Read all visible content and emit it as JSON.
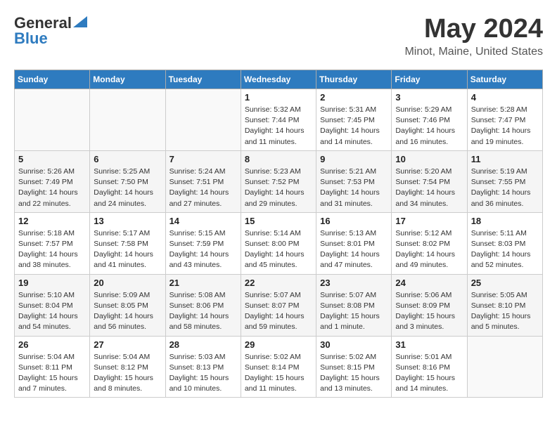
{
  "header": {
    "logo_line1": "General",
    "logo_line2": "Blue",
    "main_title": "May 2024",
    "subtitle": "Minot, Maine, United States"
  },
  "weekdays": [
    "Sunday",
    "Monday",
    "Tuesday",
    "Wednesday",
    "Thursday",
    "Friday",
    "Saturday"
  ],
  "weeks": [
    [
      {
        "day": "",
        "info": ""
      },
      {
        "day": "",
        "info": ""
      },
      {
        "day": "",
        "info": ""
      },
      {
        "day": "1",
        "info": "Sunrise: 5:32 AM\nSunset: 7:44 PM\nDaylight: 14 hours\nand 11 minutes."
      },
      {
        "day": "2",
        "info": "Sunrise: 5:31 AM\nSunset: 7:45 PM\nDaylight: 14 hours\nand 14 minutes."
      },
      {
        "day": "3",
        "info": "Sunrise: 5:29 AM\nSunset: 7:46 PM\nDaylight: 14 hours\nand 16 minutes."
      },
      {
        "day": "4",
        "info": "Sunrise: 5:28 AM\nSunset: 7:47 PM\nDaylight: 14 hours\nand 19 minutes."
      }
    ],
    [
      {
        "day": "5",
        "info": "Sunrise: 5:26 AM\nSunset: 7:49 PM\nDaylight: 14 hours\nand 22 minutes."
      },
      {
        "day": "6",
        "info": "Sunrise: 5:25 AM\nSunset: 7:50 PM\nDaylight: 14 hours\nand 24 minutes."
      },
      {
        "day": "7",
        "info": "Sunrise: 5:24 AM\nSunset: 7:51 PM\nDaylight: 14 hours\nand 27 minutes."
      },
      {
        "day": "8",
        "info": "Sunrise: 5:23 AM\nSunset: 7:52 PM\nDaylight: 14 hours\nand 29 minutes."
      },
      {
        "day": "9",
        "info": "Sunrise: 5:21 AM\nSunset: 7:53 PM\nDaylight: 14 hours\nand 31 minutes."
      },
      {
        "day": "10",
        "info": "Sunrise: 5:20 AM\nSunset: 7:54 PM\nDaylight: 14 hours\nand 34 minutes."
      },
      {
        "day": "11",
        "info": "Sunrise: 5:19 AM\nSunset: 7:55 PM\nDaylight: 14 hours\nand 36 minutes."
      }
    ],
    [
      {
        "day": "12",
        "info": "Sunrise: 5:18 AM\nSunset: 7:57 PM\nDaylight: 14 hours\nand 38 minutes."
      },
      {
        "day": "13",
        "info": "Sunrise: 5:17 AM\nSunset: 7:58 PM\nDaylight: 14 hours\nand 41 minutes."
      },
      {
        "day": "14",
        "info": "Sunrise: 5:15 AM\nSunset: 7:59 PM\nDaylight: 14 hours\nand 43 minutes."
      },
      {
        "day": "15",
        "info": "Sunrise: 5:14 AM\nSunset: 8:00 PM\nDaylight: 14 hours\nand 45 minutes."
      },
      {
        "day": "16",
        "info": "Sunrise: 5:13 AM\nSunset: 8:01 PM\nDaylight: 14 hours\nand 47 minutes."
      },
      {
        "day": "17",
        "info": "Sunrise: 5:12 AM\nSunset: 8:02 PM\nDaylight: 14 hours\nand 49 minutes."
      },
      {
        "day": "18",
        "info": "Sunrise: 5:11 AM\nSunset: 8:03 PM\nDaylight: 14 hours\nand 52 minutes."
      }
    ],
    [
      {
        "day": "19",
        "info": "Sunrise: 5:10 AM\nSunset: 8:04 PM\nDaylight: 14 hours\nand 54 minutes."
      },
      {
        "day": "20",
        "info": "Sunrise: 5:09 AM\nSunset: 8:05 PM\nDaylight: 14 hours\nand 56 minutes."
      },
      {
        "day": "21",
        "info": "Sunrise: 5:08 AM\nSunset: 8:06 PM\nDaylight: 14 hours\nand 58 minutes."
      },
      {
        "day": "22",
        "info": "Sunrise: 5:07 AM\nSunset: 8:07 PM\nDaylight: 14 hours\nand 59 minutes."
      },
      {
        "day": "23",
        "info": "Sunrise: 5:07 AM\nSunset: 8:08 PM\nDaylight: 15 hours\nand 1 minute."
      },
      {
        "day": "24",
        "info": "Sunrise: 5:06 AM\nSunset: 8:09 PM\nDaylight: 15 hours\nand 3 minutes."
      },
      {
        "day": "25",
        "info": "Sunrise: 5:05 AM\nSunset: 8:10 PM\nDaylight: 15 hours\nand 5 minutes."
      }
    ],
    [
      {
        "day": "26",
        "info": "Sunrise: 5:04 AM\nSunset: 8:11 PM\nDaylight: 15 hours\nand 7 minutes."
      },
      {
        "day": "27",
        "info": "Sunrise: 5:04 AM\nSunset: 8:12 PM\nDaylight: 15 hours\nand 8 minutes."
      },
      {
        "day": "28",
        "info": "Sunrise: 5:03 AM\nSunset: 8:13 PM\nDaylight: 15 hours\nand 10 minutes."
      },
      {
        "day": "29",
        "info": "Sunrise: 5:02 AM\nSunset: 8:14 PM\nDaylight: 15 hours\nand 11 minutes."
      },
      {
        "day": "30",
        "info": "Sunrise: 5:02 AM\nSunset: 8:15 PM\nDaylight: 15 hours\nand 13 minutes."
      },
      {
        "day": "31",
        "info": "Sunrise: 5:01 AM\nSunset: 8:16 PM\nDaylight: 15 hours\nand 14 minutes."
      },
      {
        "day": "",
        "info": ""
      }
    ]
  ]
}
